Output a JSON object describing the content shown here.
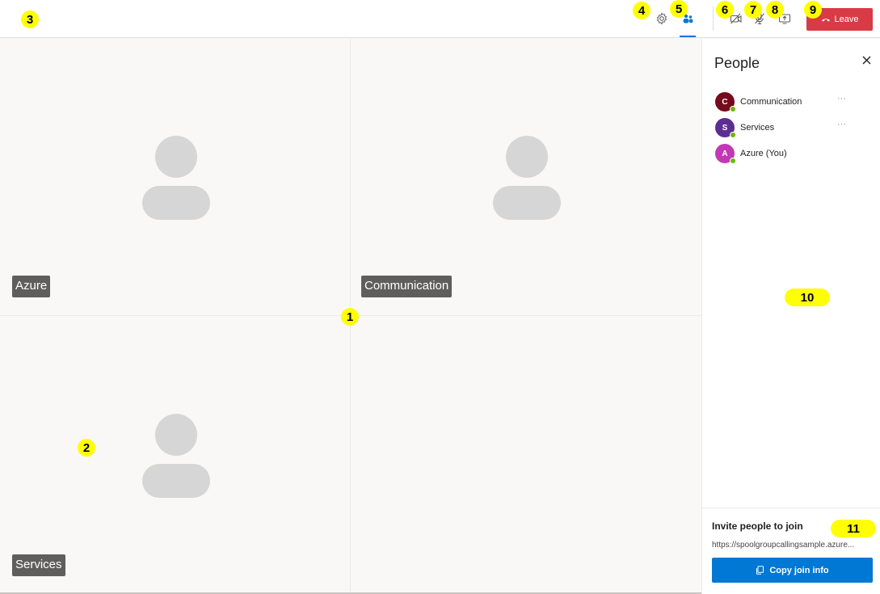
{
  "header": {
    "settings_icon": "gear-icon",
    "people_icon": "people-icon",
    "camera_icon": "camera-off-icon",
    "mic_icon": "mic-off-icon",
    "share_icon": "screen-share-icon",
    "leave_label": "Leave",
    "leave_icon": "hang-up-icon",
    "leave_color": "#d83b45",
    "accent_color": "#0078d4"
  },
  "gallery": {
    "tiles": [
      {
        "label": "Azure"
      },
      {
        "label": "Communication"
      },
      {
        "label": "Services"
      },
      {
        "label": ""
      }
    ]
  },
  "people_pane": {
    "title": "People",
    "close_icon": "close-icon",
    "participants": [
      {
        "initial": "C",
        "name": "Communication",
        "color": "#750b1c",
        "more": "···"
      },
      {
        "initial": "S",
        "name": "Services",
        "color": "#5c2e91",
        "more": "···"
      },
      {
        "initial": "A",
        "name": "Azure (You)",
        "color": "#c239b3",
        "more": ""
      }
    ],
    "presence_color": "#6bb700",
    "invite": {
      "title": "Invite people to join",
      "url": "https://spoolgroupcallingsample.azure...",
      "copy_label": "Copy join info",
      "copy_icon": "copy-icon"
    }
  },
  "callouts": [
    "1",
    "2",
    "3",
    "4",
    "5",
    "6",
    "7",
    "8",
    "9",
    "10",
    "11"
  ]
}
